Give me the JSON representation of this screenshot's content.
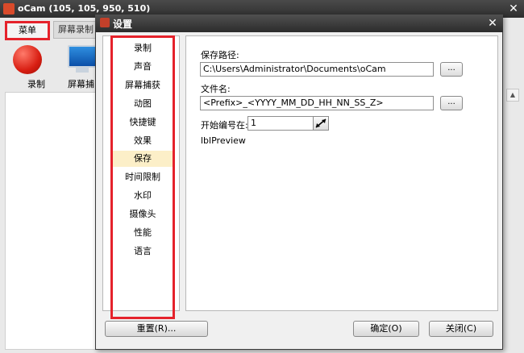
{
  "background_window": {
    "title": "oCam (105, 105, 950, 510)",
    "tabs": [
      "菜单",
      "屏幕录制"
    ],
    "toolbar": [
      "录制",
      "屏幕捕"
    ]
  },
  "dialog": {
    "title": "设置",
    "close_icon": "close-icon",
    "nav": {
      "items": [
        "录制",
        "声音",
        "屏幕捕获",
        "动图",
        "快捷键",
        "效果",
        "保存",
        "时间限制",
        "水印",
        "摄像头",
        "性能",
        "语言"
      ],
      "selected": "保存"
    },
    "content": {
      "save_path_label": "保存路径:",
      "save_path_value": "C:\\Users\\Administrator\\Documents\\oCam",
      "browse_label": "...",
      "filename_label": "文件名:",
      "filename_value": "<Prefix>_<YYYY_MM_DD_HH_NN_SS_Z>",
      "filename_btn_label": "...",
      "start_number_label": "开始编号在:",
      "start_number_value": "1",
      "preview_label": "lblPreview"
    },
    "buttons": {
      "reset": "重置(R)...",
      "ok": "确定(O)",
      "close": "关闭(C)"
    }
  },
  "colors": {
    "highlight_red": "#e5222b",
    "selected_item_bg": "#fcefc8"
  }
}
